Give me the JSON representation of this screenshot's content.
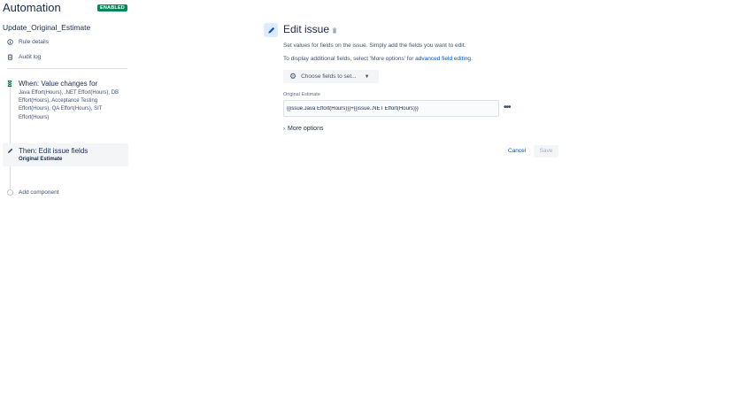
{
  "header": {
    "title": "Automation",
    "status_badge": "ENABLED"
  },
  "rule": {
    "name": "Update_Original_Estimate"
  },
  "sidebar": {
    "links": [
      {
        "label": "Rule details",
        "icon": "info-icon"
      },
      {
        "label": "Audit log",
        "icon": "clipboard-icon"
      }
    ],
    "trigger": {
      "title": "When: Value changes for",
      "description": "Java Effort(Hours), .NET Effort(Hours), DB Effort(Hours), Acceptance Testing Effort(Hours), QA Effort(Hours), SIT Effort(Hours)",
      "icon": "trigger-icon"
    },
    "action": {
      "title": "Then: Edit issue fields",
      "subtitle": "Original Estimate",
      "icon": "pencil-icon"
    },
    "add_component": "Add component"
  },
  "editor": {
    "title": "Edit issue",
    "help_line1": "Set values for fields on the issue. Simply add the fields you want to edit.",
    "help_line2_prefix": "To display additional fields, select 'More options' for ",
    "help_line2_link": "advanced field editing",
    "help_line2_suffix": ".",
    "choose_fields_label": "Choose fields to set...",
    "field_label": "Original Estimate",
    "field_value": "{{issue.Java Effort(Hours)}}+{{issue..NET Effort(Hours)}}",
    "more_options_label": "More options",
    "cancel_label": "Cancel",
    "save_label": "Save"
  }
}
